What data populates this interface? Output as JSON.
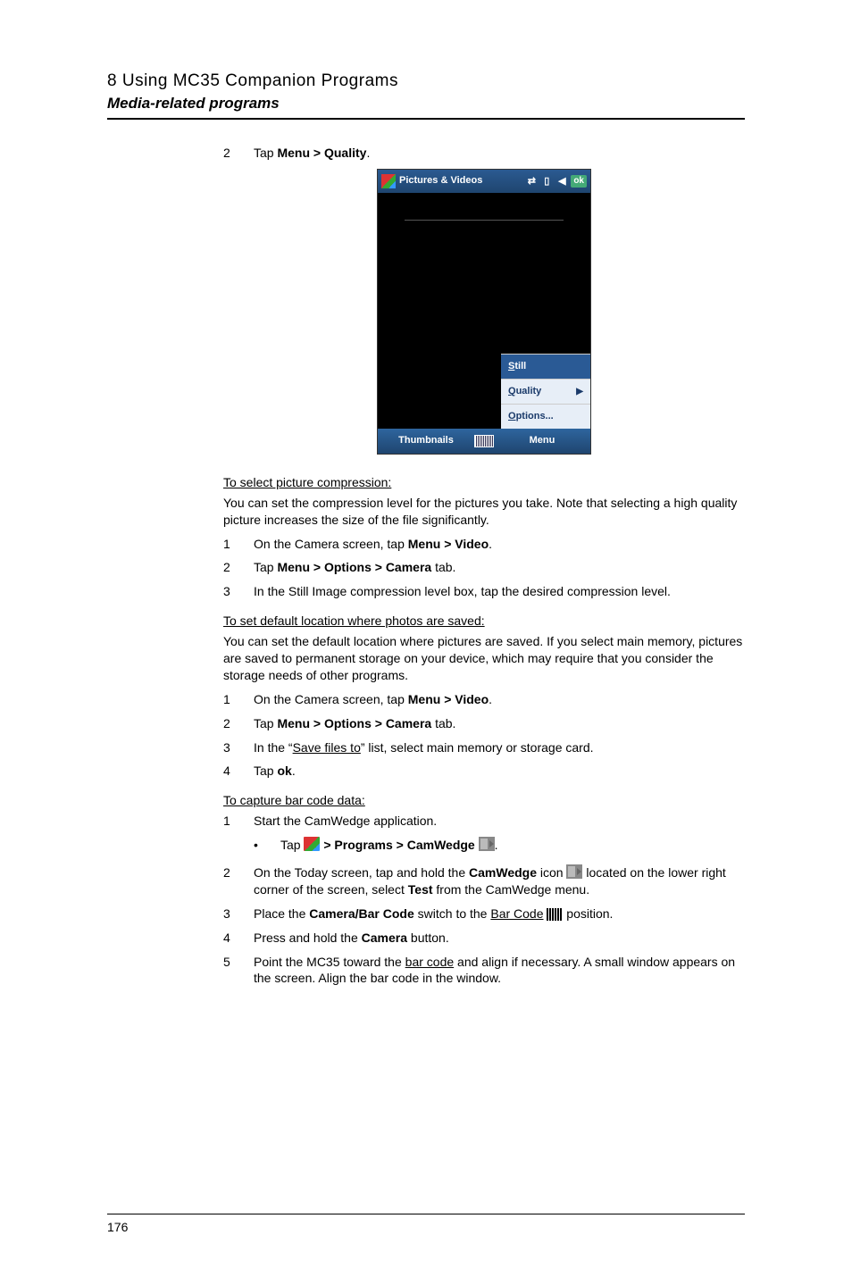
{
  "header": {
    "title": "8 Using MC35 Companion Programs",
    "subtitle": "Media-related programs"
  },
  "pageNumber": "176",
  "intro": {
    "stepNum": "2",
    "prefix": "Tap ",
    "bold": "Menu > Quality",
    "suffix": "."
  },
  "screenshot": {
    "title": "Pictures & Videos",
    "ok": "ok",
    "menuItems": {
      "still": "Still",
      "quality": "Quality",
      "options": "Options..."
    },
    "bottomLeft": "Thumbnails",
    "bottomRight": "Menu"
  },
  "sectionA": {
    "heading": "To select picture compression:",
    "para": "You can set the compression level for the pictures you take. Note that selecting a high quality picture increases the size of the file significantly.",
    "steps": [
      {
        "num": "1",
        "prefix": "On the Camera screen, tap ",
        "bold": "Menu > Video",
        "suffix": "."
      },
      {
        "num": "2",
        "prefix": "Tap ",
        "bold": "Menu > Options > Camera",
        "suffix": " tab."
      },
      {
        "num": "3",
        "text": "In the Still Image compression level box, tap the desired compression level."
      }
    ]
  },
  "sectionB": {
    "heading": "To set default location where photos are saved:",
    "para": "You can set the default location where pictures are saved. If you select main memory, pictures are saved to permanent storage on your device, which may require that you consider the storage needs of other programs.",
    "steps": [
      {
        "num": "1",
        "prefix": "On the Camera screen, tap ",
        "bold": "Menu > Video",
        "suffix": "."
      },
      {
        "num": "2",
        "prefix": "Tap ",
        "bold": "Menu > Options > Camera",
        "suffix": " tab."
      },
      {
        "num": "3",
        "pre": "In the “",
        "uline": "Save files to",
        "post": "” list, select main memory or storage card."
      },
      {
        "num": "4",
        "prefix": "Tap ",
        "bold": "ok",
        "suffix": "."
      }
    ]
  },
  "sectionC": {
    "heading": "To capture bar code data:",
    "step1": {
      "num": "1",
      "text": "Start the CamWedge application."
    },
    "bullet": {
      "prefix": "Tap ",
      "bold": " > Programs > CamWedge ",
      "suffix": "."
    },
    "step2": {
      "num": "2",
      "t1": "On the Today screen, tap and hold the ",
      "b1": "CamWedge",
      "t2": " icon ",
      "t3": " located on the lower right corner of the screen, select ",
      "b2": "Test",
      "t4": " from the CamWedge menu."
    },
    "step3": {
      "num": "3",
      "t1": "Place the ",
      "b1": "Camera/Bar Code",
      "t2": " switch to the ",
      "u1": "Bar Code",
      "t3": " ",
      "t4": " position."
    },
    "step4": {
      "num": "4",
      "t1": "Press and hold the ",
      "b1": "Camera",
      "t2": " button."
    },
    "step5": {
      "num": "5",
      "t1": "Point the MC35 toward the ",
      "u1": "bar code",
      "t2": " and align if necessary. A small window appears on the screen. Align the bar code in the window."
    }
  }
}
